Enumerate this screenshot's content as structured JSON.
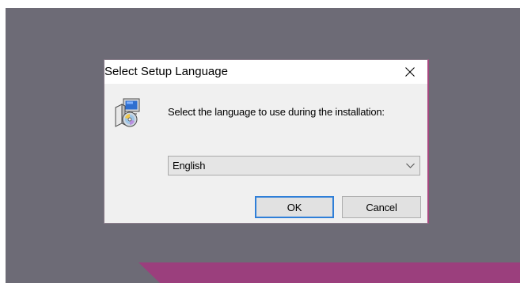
{
  "dialog": {
    "title": "Select Setup Language",
    "prompt": "Select the language to use during the installation:",
    "language_select": {
      "selected": "English"
    },
    "buttons": {
      "ok_label": "OK",
      "cancel_label": "Cancel"
    },
    "icons": {
      "close": "close-icon",
      "app": "setup-installer-icon",
      "dropdown": "chevron-down-icon"
    }
  },
  "colors": {
    "desktop_background": "#6d6b76",
    "accent_shape": "#9b3f7d",
    "dialog_background": "#f0f0f0",
    "titlebar_background": "#ffffff",
    "default_button_border": "#2f7fd8"
  }
}
